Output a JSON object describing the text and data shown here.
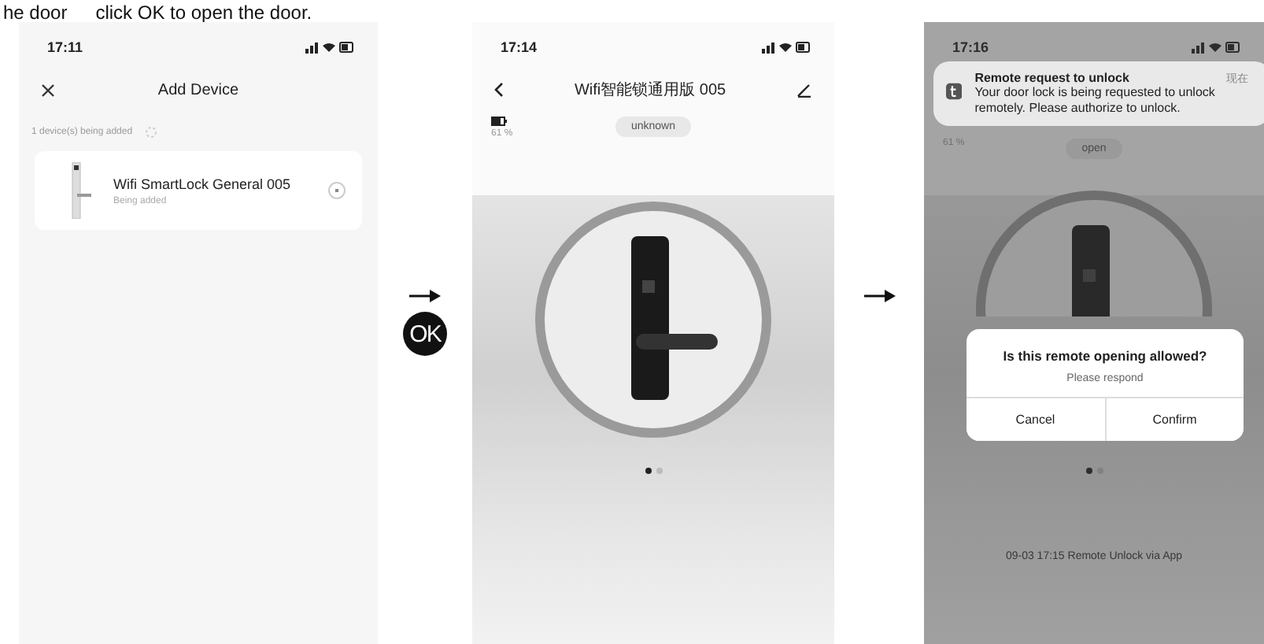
{
  "caption": {
    "fragment": "he door",
    "text": "click OK to open the door."
  },
  "screens": [
    {
      "kind": "add_device",
      "time": "17:11",
      "title": "Add Device",
      "progress_label": "1 device(s) being added",
      "device": {
        "name": "Wifi SmartLock General 005",
        "status": "Being added"
      }
    },
    {
      "kind": "lock",
      "time": "17:14",
      "title": "Wifi智能锁通用版 005",
      "battery": "61 %",
      "state": "unknown",
      "page_dots": [
        {
          "selected": true
        },
        {
          "selected": false
        }
      ]
    },
    {
      "kind": "lock_request",
      "time": "17:16",
      "battery": "61 %",
      "state": "open",
      "notification": {
        "title": "Remote request to unlock",
        "body": "Your door lock is being requested to unlock remotely. Please authorize to unlock.",
        "time": "现在"
      },
      "dialog": {
        "title": "Is this remote opening allowed?",
        "message": "Please respond",
        "buttons": [
          "Cancel",
          "Confirm"
        ]
      },
      "page_dots": [
        {
          "selected": true
        },
        {
          "selected": false
        }
      ],
      "log": "09-03 17:15  Remote Unlock via App"
    }
  ],
  "connectors": [
    {
      "kind": "ok",
      "badge": "OK"
    },
    {
      "kind": "arrow"
    }
  ]
}
